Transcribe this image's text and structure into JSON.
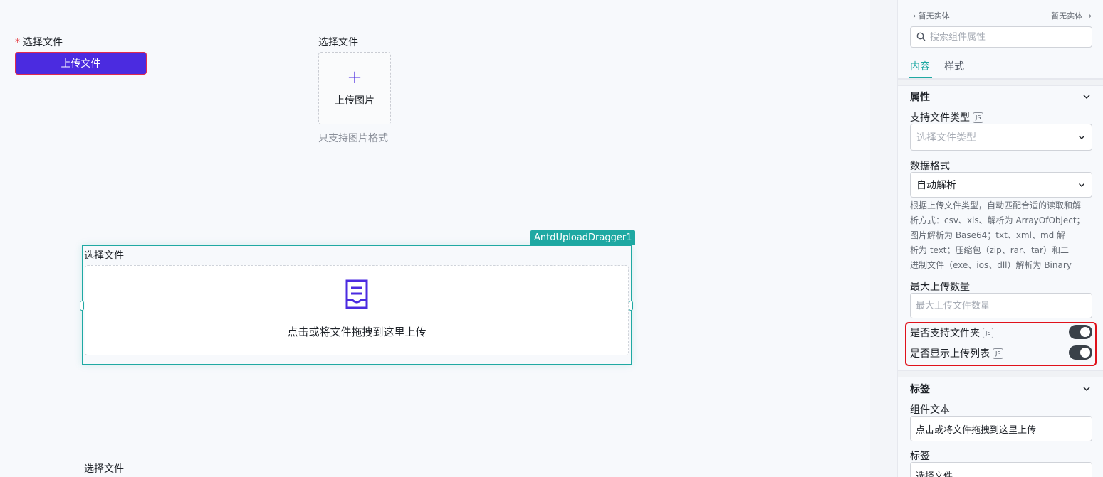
{
  "canvas": {
    "upload_field": {
      "label": "选择文件",
      "required_mark": "*",
      "button_label": "上传文件"
    },
    "image_field": {
      "label": "选择文件",
      "plus": "+",
      "card_label": "上传图片",
      "hint": "只支持图片格式"
    },
    "dragger_field": {
      "component_tag": "AntdUploadDragger1",
      "label": "选择文件",
      "drop_text": "点击或将文件拖拽到这里上传",
      "icon": "inbox-icon"
    },
    "bottom_field": {
      "label": "选择文件"
    }
  },
  "panel": {
    "top_left": "暂无实体",
    "top_right": "暂无实体",
    "search": {
      "placeholder": "搜索组件属性"
    },
    "tabs": [
      {
        "label": "内容"
      },
      {
        "label": "样式"
      }
    ],
    "properties": {
      "title": "属性",
      "file_type": {
        "label": "支持文件类型",
        "js": "JS",
        "placeholder": "选择文件类型"
      },
      "data_format": {
        "label": "数据格式",
        "value": "自动解析"
      },
      "description": [
        "根据上传文件类型，自动匹配合适的读取和解",
        "析方式：csv、xls、解析为 ArrayOfObject；",
        "图片解析为 Base64；txt、xml、md 解",
        "析为 text；压缩包（zip、rar、tar）和二",
        "进制文件（exe、ios、dll）解析为 Binary"
      ],
      "max_count": {
        "label": "最大上传数量",
        "placeholder": "最大上传文件数量"
      },
      "support_folder": {
        "label": "是否支持文件夹",
        "js": "JS",
        "enabled": true
      },
      "show_list": {
        "label": "是否显示上传列表",
        "js": "JS",
        "enabled": true
      }
    },
    "label_section": {
      "title": "标签",
      "component_text": {
        "label": "组件文本",
        "value": "点击或将文件拖拽到这里上传"
      },
      "label": {
        "label": "标签",
        "value": "选择文件"
      }
    }
  },
  "colors": {
    "primary": "#4b2be0",
    "teal": "#1fa9a3",
    "highlight": "#e0121b"
  }
}
